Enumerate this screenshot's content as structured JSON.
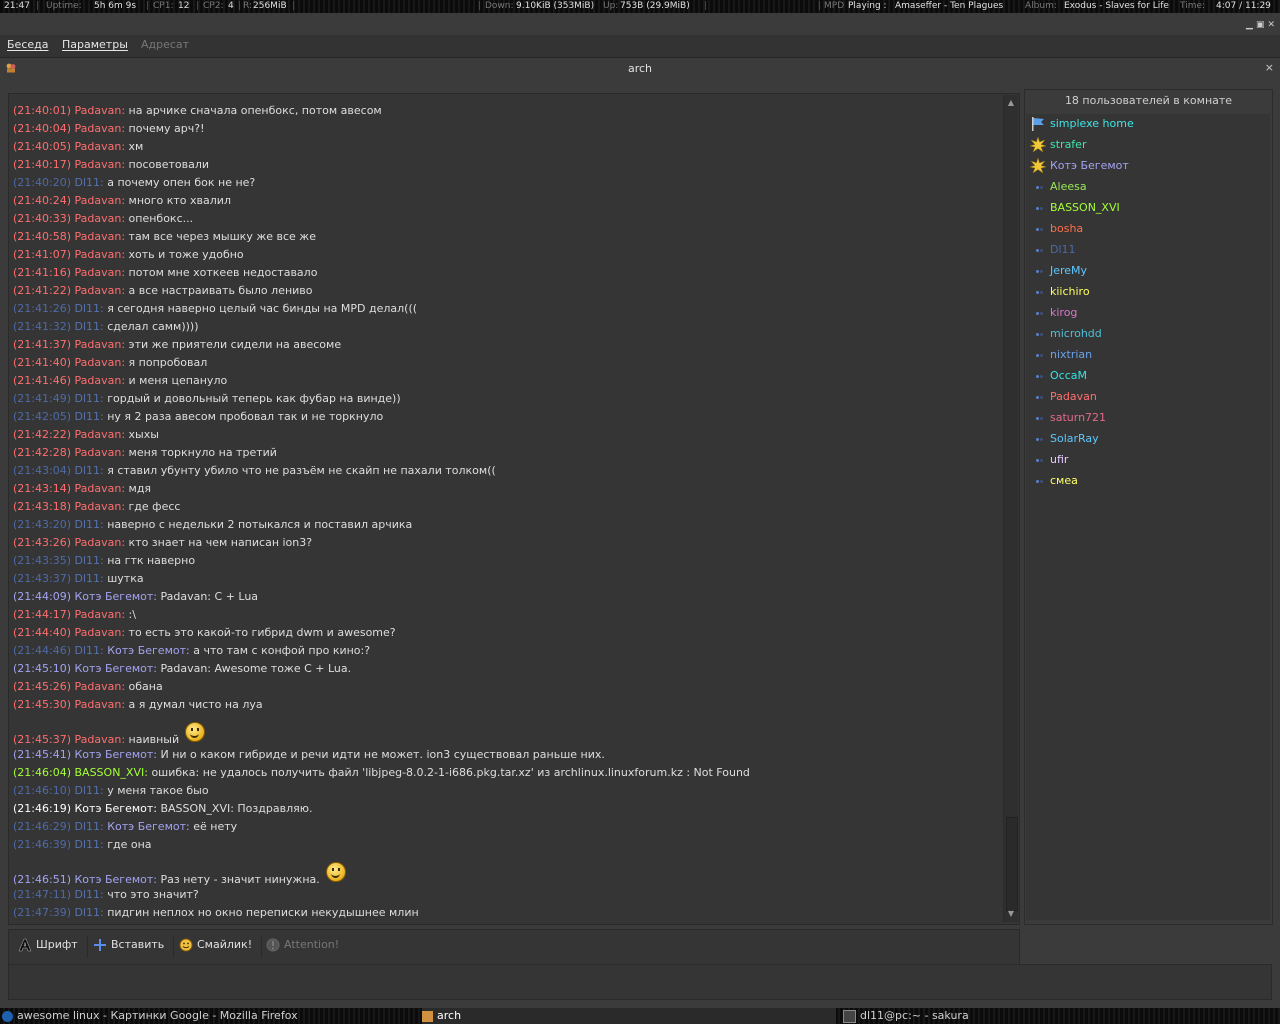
{
  "topbar": {
    "clock": "21:47",
    "uptime_label": "Uptime:",
    "uptime": "5h 6m 9s",
    "cpu1_label": "CP1:",
    "cpu1": "12",
    "cpu2_label": "CP2:",
    "cpu2": "4",
    "ram_label": "R:",
    "ram": "256MiB",
    "down_label": "Down:",
    "down": "9.10KiB (353MiB)",
    "up_label": "Up:",
    "up": "753B (29.9MiB)",
    "mpd_label": "MPD",
    "mpd_state": "Playing :",
    "artist": "Amaseffer - Ten Plagues",
    "album_label": "Album:",
    "album": "Exodus - Slaves for Life",
    "time_label": "Time:",
    "time": "4:07 / 11:29"
  },
  "menu": {
    "conversation": "Беседа",
    "options": "Параметры",
    "addressee": "Адресат"
  },
  "window": {
    "title": "arch",
    "close": "×"
  },
  "chat": {
    "messages": [
      {
        "ts": "(21:40:01)",
        "nick": "Padavan:",
        "text": "на арчике сначала опенбокс, потом авесом",
        "c": "pad"
      },
      {
        "ts": "(21:40:04)",
        "nick": "Padavan:",
        "text": "почему арч?!",
        "c": "pad"
      },
      {
        "ts": "(21:40:05)",
        "nick": "Padavan:",
        "text": "хм",
        "c": "pad"
      },
      {
        "ts": "(21:40:17)",
        "nick": "Padavan:",
        "text": "посоветовали",
        "c": "pad"
      },
      {
        "ts": "(21:40:20)",
        "nick": "Dl11:",
        "text": "а почему опен бок не не?",
        "c": "dl"
      },
      {
        "ts": "(21:40:24)",
        "nick": "Padavan:",
        "text": "много кто хвалил",
        "c": "pad"
      },
      {
        "ts": "(21:40:33)",
        "nick": "Padavan:",
        "text": "опенбокс...",
        "c": "pad"
      },
      {
        "ts": "(21:40:58)",
        "nick": "Padavan:",
        "text": "там все через мышку же все же",
        "c": "pad"
      },
      {
        "ts": "(21:41:07)",
        "nick": "Padavan:",
        "text": "хоть и тоже удобно",
        "c": "pad"
      },
      {
        "ts": "(21:41:16)",
        "nick": "Padavan:",
        "text": "потом мне хоткеев недоставало",
        "c": "pad"
      },
      {
        "ts": "(21:41:22)",
        "nick": "Padavan:",
        "text": "а все настраивать было лениво",
        "c": "pad"
      },
      {
        "ts": "(21:41:26)",
        "nick": "Dl11:",
        "text": "я сегодня наверно целый час бинды на MPD делал(((",
        "c": "dl"
      },
      {
        "ts": "(21:41:32)",
        "nick": "Dl11:",
        "text": "сделал самм))))",
        "c": "dl"
      },
      {
        "ts": "(21:41:37)",
        "nick": "Padavan:",
        "text": "эти же приятели сидели на авесоме",
        "c": "pad"
      },
      {
        "ts": "(21:41:40)",
        "nick": "Padavan:",
        "text": "я попробовал",
        "c": "pad"
      },
      {
        "ts": "(21:41:46)",
        "nick": "Padavan:",
        "text": "и меня цепануло",
        "c": "pad"
      },
      {
        "ts": "(21:41:49)",
        "nick": "Dl11:",
        "text": "гордый и довольный теперь как фубар на винде))",
        "c": "dl"
      },
      {
        "ts": "(21:42:05)",
        "nick": "Dl11:",
        "text": "ну я 2 раза авесом пробовал так и не торкнуло",
        "c": "dl"
      },
      {
        "ts": "(21:42:22)",
        "nick": "Padavan:",
        "text": "хыхы",
        "c": "pad"
      },
      {
        "ts": "(21:42:28)",
        "nick": "Padavan:",
        "text": "меня торкнуло на третий",
        "c": "pad"
      },
      {
        "ts": "(21:43:04)",
        "nick": "Dl11:",
        "text": "я ставил убунту убило что не разъём не скайп не пахали толком((",
        "c": "dl"
      },
      {
        "ts": "(21:43:14)",
        "nick": "Padavan:",
        "text": "мдя",
        "c": "pad"
      },
      {
        "ts": "(21:43:18)",
        "nick": "Padavan:",
        "text": "где фесс",
        "c": "pad"
      },
      {
        "ts": "(21:43:20)",
        "nick": "Dl11:",
        "text": "наверно с недельки 2 потыкался и поставил арчика",
        "c": "dl"
      },
      {
        "ts": "(21:43:26)",
        "nick": "Padavan:",
        "text": "кто знает на чем написан ion3?",
        "c": "pad"
      },
      {
        "ts": "(21:43:35)",
        "nick": "Dl11:",
        "text": "на гтк наверно",
        "c": "dl"
      },
      {
        "ts": "(21:43:37)",
        "nick": "Dl11:",
        "text": "шутка",
        "c": "dl"
      },
      {
        "ts": "(21:44:09)",
        "nick": "Котэ Бегемот:",
        "text": "Padavan: C + Lua",
        "c": "kotz"
      },
      {
        "ts": "(21:44:17)",
        "nick": "Padavan:",
        "text": ":\\",
        "c": "pad"
      },
      {
        "ts": "(21:44:40)",
        "nick": "Padavan:",
        "text": "то есть это какой-то гибрид dwm и awesome?",
        "c": "pad"
      },
      {
        "ts": "(21:44:46)",
        "nick": "Dl11:",
        "text": "Котэ Бегемот: а что там с конфой про кино:?",
        "c": "dl",
        "textc": "kotz-mention",
        "mention": "Котэ Бегемот:",
        "rest": " а что там с конфой про кино:?"
      },
      {
        "ts": "(21:45:10)",
        "nick": "Котэ Бегемот:",
        "text": "Padavan: Awesome тоже C + Lua.",
        "c": "kotz"
      },
      {
        "ts": "(21:45:26)",
        "nick": "Padavan:",
        "text": "обана",
        "c": "pad"
      },
      {
        "ts": "(21:45:30)",
        "nick": "Padavan:",
        "text": "а я думал чисто на луа",
        "c": "pad"
      },
      {
        "ts": "(21:45:37)",
        "nick": "Padavan:",
        "text": "наивный",
        "c": "pad",
        "smiley": true
      },
      {
        "ts": "(21:45:41)",
        "nick": "Котэ Бегемот:",
        "text": "И ни о каком гибриде и речи идти не может. ion3 существовал раньше них.",
        "c": "kotz"
      },
      {
        "ts": "(21:46:04)",
        "nick": "BASSON_XVI:",
        "text": "ошибка: не удалось получить файл 'libjpeg-8.0.2-1-i686.pkg.tar.xz' из archlinux.linuxforum.kz : Not Found",
        "c": "basson"
      },
      {
        "ts": "(21:46:10)",
        "nick": "Dl11:",
        "text": "у меня такое быо",
        "c": "dl"
      },
      {
        "ts": "(21:46:19)",
        "nick": "Котэ Бегемот:",
        "text": "BASSON_XVI: Поздравляю.",
        "c": "white"
      },
      {
        "ts": "(21:46:29)",
        "nick": "Dl11:",
        "text": "её нету",
        "c": "dl",
        "mention": "Котэ Бегемот:",
        "rest": " её нету"
      },
      {
        "ts": "(21:46:39)",
        "nick": "Dl11:",
        "text": "где она",
        "c": "dl"
      },
      {
        "ts": "(21:46:51)",
        "nick": "Котэ Бегемот:",
        "text": "Раз нету - значит нинужна.",
        "c": "kotz",
        "smiley": true
      },
      {
        "ts": "(21:47:11)",
        "nick": "Dl11:",
        "text": "что это значит?",
        "c": "dl"
      },
      {
        "ts": "(21:47:39)",
        "nick": "Dl11:",
        "text": "пидгин неплох но окно переписки некудышнее млин",
        "c": "dl"
      }
    ]
  },
  "users": {
    "count_text": "18 пользователей в комнате",
    "list": [
      {
        "name": "simplexe home",
        "color": "#3ee6e6",
        "icon": "flag-icon"
      },
      {
        "name": "strafer",
        "color": "#3ee6b0",
        "icon": "sun-icon"
      },
      {
        "name": "Котэ Бегемот",
        "color": "#a3a3f2",
        "icon": "sun-icon"
      },
      {
        "name": "Aleesa",
        "color": "#9be65a",
        "icon": "dot-icon"
      },
      {
        "name": "BASSON_XVI",
        "color": "#a5ff36",
        "icon": "dot-icon"
      },
      {
        "name": "bosha",
        "color": "#ff6e4a",
        "icon": "dot-icon"
      },
      {
        "name": "Dl11",
        "color": "#4e6aa6",
        "icon": "dot-icon"
      },
      {
        "name": "JereMy",
        "color": "#5ec8ff",
        "icon": "dot-icon"
      },
      {
        "name": "kiichiro",
        "color": "#ffff66",
        "icon": "dot-icon"
      },
      {
        "name": "kirog",
        "color": "#d877c8",
        "icon": "dot-icon"
      },
      {
        "name": "microhdd",
        "color": "#4ec0d8",
        "icon": "dot-icon"
      },
      {
        "name": "nixtrian",
        "color": "#6aa0e8",
        "icon": "dot-icon"
      },
      {
        "name": "OccaM",
        "color": "#33e6e6",
        "icon": "dot-icon"
      },
      {
        "name": "Padavan",
        "color": "#ff6e6e",
        "icon": "dot-icon"
      },
      {
        "name": "saturn721",
        "color": "#e06a8a",
        "icon": "dot-icon"
      },
      {
        "name": "SolarRay",
        "color": "#5ec8ff",
        "icon": "dot-icon"
      },
      {
        "name": "ufir",
        "color": "#e6c8ff",
        "icon": "dot-icon"
      },
      {
        "name": "смеа",
        "color": "#ffff66",
        "icon": "dot-icon"
      }
    ]
  },
  "toolbar": {
    "font": "Шрифт",
    "insert": "Вставить",
    "smiley": "Смайлик!",
    "attention": "Attention!"
  },
  "taskbar": {
    "firefox": "awesome linux - Картинки Google - Mozilla Firefox",
    "arch": "arch",
    "terminal": "dl11@pc:~ - sakura"
  }
}
